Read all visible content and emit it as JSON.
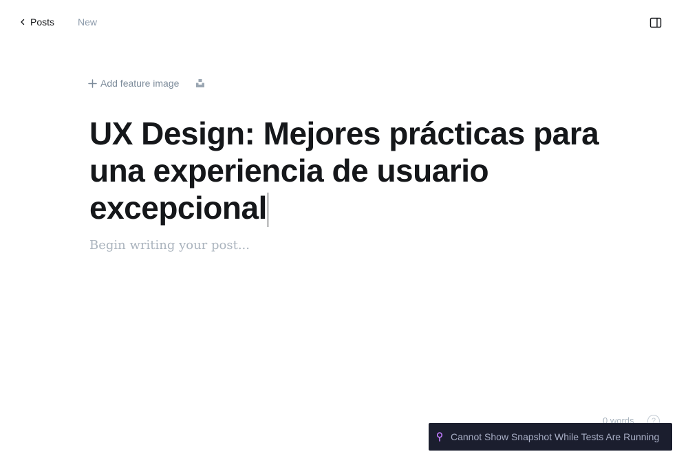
{
  "header": {
    "back_label": "Posts",
    "status": "New"
  },
  "editor": {
    "add_feature_image": "Add feature image",
    "title": "UX Design: Mejores prácticas para una experiencia de usuario excepcional",
    "body_placeholder": "Begin writing your post..."
  },
  "footer": {
    "word_count": "0 words",
    "help_label": "?"
  },
  "toast": {
    "message": "Cannot Show Snapshot While Tests Are Running"
  },
  "icons": {
    "back": "chevron-left-icon",
    "sidebar": "sidebar-panel-icon",
    "add": "plus-icon",
    "unsplash": "unsplash-icon",
    "pin": "pin-icon"
  },
  "colors": {
    "text": "#15171a",
    "muted": "#8e9cac",
    "toast_bg": "#1b1e2e",
    "pin": "#c17bff"
  }
}
